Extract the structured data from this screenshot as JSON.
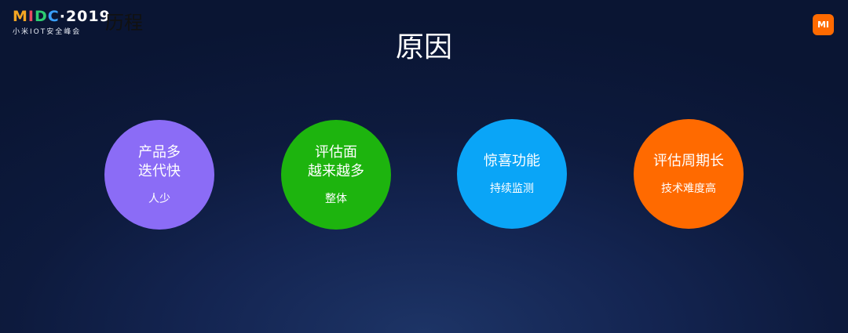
{
  "logo": {
    "letters": [
      {
        "char": "M",
        "color": "#f5a623"
      },
      {
        "char": "I",
        "color": "#e84a5f"
      },
      {
        "char": "D",
        "color": "#2ecc71"
      },
      {
        "char": "C",
        "color": "#3aa0ff"
      },
      {
        "char": "·",
        "color": "#ffffff"
      },
      {
        "char": "2019",
        "color": "#ffffff"
      }
    ],
    "subtitle": "小米IOT安全峰会"
  },
  "section_label": "历程",
  "brand_badge": "MI",
  "title": "原因",
  "circles": [
    {
      "lines": [
        "产品多",
        "迭代快"
      ],
      "sub": "人少",
      "color": "#8b6cf6"
    },
    {
      "lines": [
        "评估面",
        "越来越多"
      ],
      "sub": "整体",
      "color": "#1db40e"
    },
    {
      "lines": [
        "惊喜功能",
        ""
      ],
      "sub": "持续监测",
      "color": "#0aa5f7"
    },
    {
      "lines": [
        "评估周期长",
        ""
      ],
      "sub": "技术难度高",
      "color": "#ff6a00"
    }
  ]
}
